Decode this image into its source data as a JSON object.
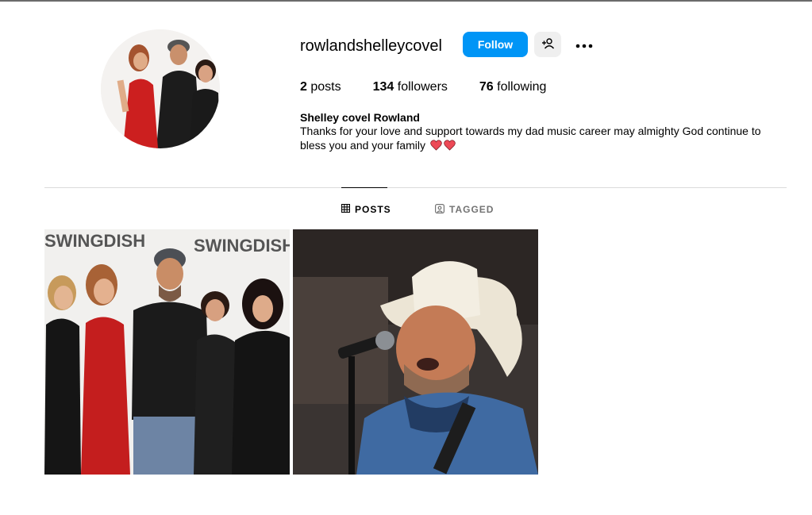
{
  "profile": {
    "username": "rowlandshelleycovel",
    "follow_label": "Follow",
    "display_name": "Shelley covel Rowland",
    "bio": "Thanks for your love and support towards my dad music career may almighty God continue to bless you and your family"
  },
  "stats": {
    "posts_count": "2",
    "posts_label": "posts",
    "followers_count": "134",
    "followers_label": "followers",
    "following_count": "76",
    "following_label": "following"
  },
  "tabs": {
    "posts_label": "POSTS",
    "tagged_label": "TAGGED",
    "active": "posts"
  },
  "posts": {
    "post1_backdrop_text": "SWINGDISH"
  },
  "colors": {
    "accent": "#0095f6",
    "heart": "#ed4956",
    "muted": "#737373"
  },
  "icons": [
    "add-user-icon",
    "more-icon",
    "grid-icon",
    "tagged-icon",
    "heart-icon"
  ]
}
